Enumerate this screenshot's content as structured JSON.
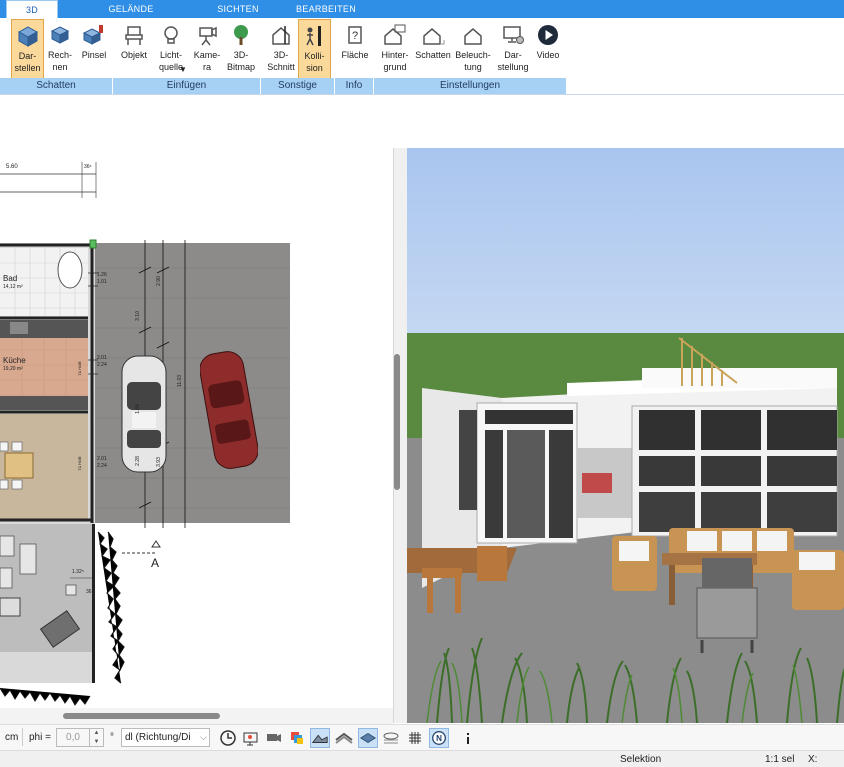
{
  "tabs": [
    {
      "label": "3D",
      "active": true
    },
    {
      "label": "GELÄNDE"
    },
    {
      "label": "SICHTEN"
    },
    {
      "label": "BEARBEITEN"
    }
  ],
  "ribbon": {
    "darstellen": "Dar-\nstellen",
    "rechnen": "Rech-\nnen",
    "pinsel": "Pinsel",
    "objekt": "Objekt",
    "lichtquelle": "Licht-\nquelle",
    "kamera": "Kame-\nra",
    "bitmap": "3D-\nBitmap",
    "schnitt": "3D-\nSchnitt",
    "kollision": "Kolli-\nsion",
    "flaeche": "Fläche",
    "hintergrund": "Hinter-\ngrund",
    "schatten": "Schatten",
    "beleuchtung": "Beleuch-\ntung",
    "darstellung": "Dar-\nstellung",
    "video": "Video"
  },
  "groups": {
    "schatten": "Schatten",
    "einfuegen": "Einfügen",
    "sonstige": "Sonstige",
    "info": "Info",
    "einstellungen": "Einstellungen"
  },
  "plan": {
    "dim_top": "5.60",
    "dim_top_small": "36⁵",
    "room_bad": "Bad",
    "room_bad_area": "14,12 m²",
    "room_kueche": "Küche",
    "room_kueche_area": "19,20 m²",
    "dim_126": "1.26",
    "dim_101": "1.01",
    "dim_201a": "2.01",
    "dim_224a": "2.24",
    "dim_201b": "2.01",
    "dim_224b": "2.24",
    "dim_132": "1.32⁵",
    "dim_36": "36",
    "section_label": "A",
    "brh_a": "BRH 51",
    "brh_b": "BRH 51",
    "dim_v1": "3.10",
    "dim_v2": "2.90",
    "dim_v3": "1.84",
    "dim_v4": "2.28",
    "dim_v5": "11.03",
    "dim_v6": "3.93"
  },
  "toolbar": {
    "unit": "cm",
    "phi_label": "phi =",
    "phi_value": "0,0",
    "degree": "°",
    "dl_value": "dl (Richtung/Di"
  },
  "status": {
    "mode": "Selektion",
    "scale": "1:1 sel",
    "x_label": "X:"
  },
  "colors": {
    "tab_bar": "#2f8ee6",
    "group_bar": "#a7d0f5",
    "selected": "#fbd99b"
  }
}
